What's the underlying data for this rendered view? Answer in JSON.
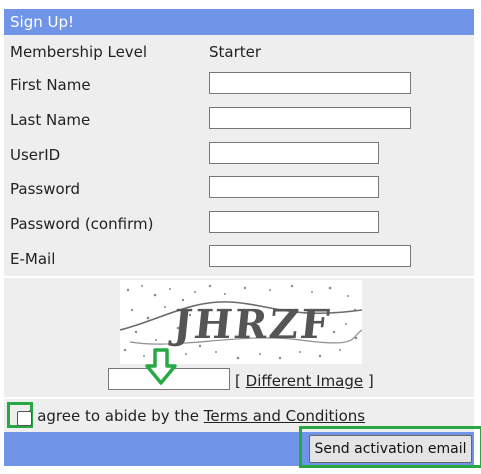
{
  "header": {
    "title": "Sign Up!"
  },
  "fields": {
    "membership_label": "Membership Level",
    "membership_value": "Starter",
    "first_name_label": "First Name",
    "last_name_label": "Last Name",
    "userid_label": "UserID",
    "password_label": "Password",
    "password_confirm_label": "Password (confirm)",
    "email_label": "E-Mail"
  },
  "captcha": {
    "image_text": "JHRZF",
    "different_image_label": "Different Image",
    "bracket_open": "[",
    "bracket_close": "]"
  },
  "agree": {
    "text": "I agree to abide by the ",
    "terms_link": "Terms and Conditions"
  },
  "footer": {
    "send_button": "Send activation email"
  },
  "colors": {
    "header_bg": "#7094e8",
    "row_bg": "#eeeeee",
    "highlight": "#27a844"
  },
  "icons": {
    "arrow": "down-arrow-icon"
  }
}
